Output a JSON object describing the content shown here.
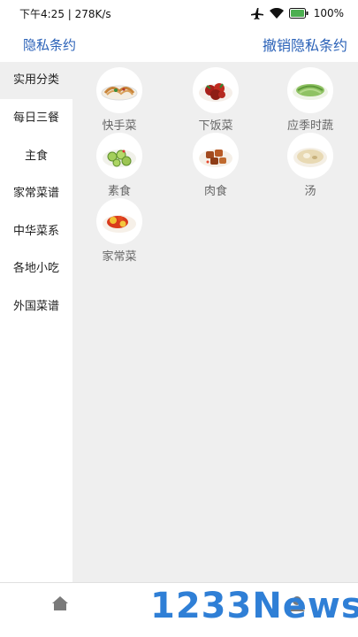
{
  "status": {
    "time_speed": "下午4:25 | 278K/s",
    "battery": "100%"
  },
  "header": {
    "left_link": "隐私条约",
    "right_link": "撤销隐私条约"
  },
  "sidebar": {
    "items": [
      {
        "label": "实用分类",
        "active": true
      },
      {
        "label": "每日三餐"
      },
      {
        "label": "主食"
      },
      {
        "label": "家常菜谱"
      },
      {
        "label": "中华菜系"
      },
      {
        "label": "各地小吃"
      },
      {
        "label": "外国菜谱"
      }
    ]
  },
  "categories": [
    {
      "label": "快手菜",
      "icon": "dish-noodles-icon"
    },
    {
      "label": "下饭菜",
      "icon": "dish-braised-icon"
    },
    {
      "label": "应季时蔬",
      "icon": "dish-greens-icon"
    },
    {
      "label": "素食",
      "icon": "dish-cucumber-icon"
    },
    {
      "label": "肉食",
      "icon": "dish-meat-icon"
    },
    {
      "label": "汤",
      "icon": "dish-soup-icon"
    },
    {
      "label": "家常菜",
      "icon": "dish-tomato-egg-icon"
    }
  ],
  "watermark": "1233News"
}
